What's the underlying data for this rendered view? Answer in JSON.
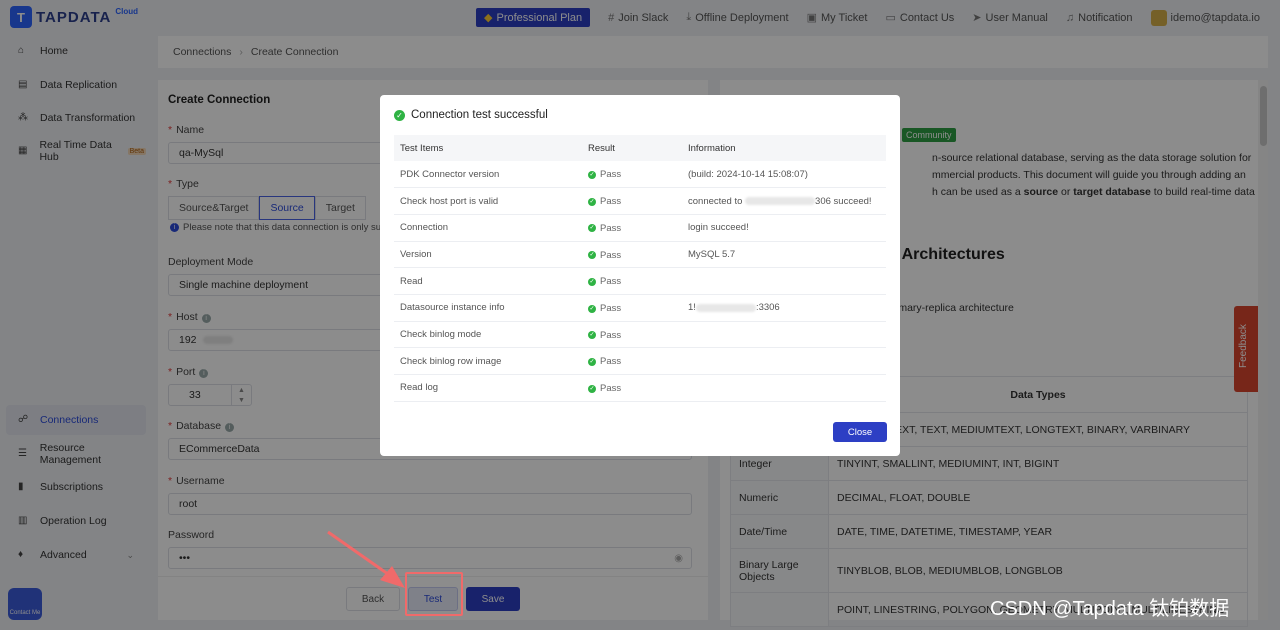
{
  "brand": {
    "name": "TAPDATA",
    "tag": "Cloud"
  },
  "topnav": {
    "plan": "Professional Plan",
    "slack": "Join Slack",
    "offline": "Offline Deployment",
    "ticket": "My Ticket",
    "contact": "Contact Us",
    "manual": "User Manual",
    "notification": "Notification",
    "user": "idemo@tapdata.io"
  },
  "sidebar": {
    "items": [
      {
        "label": "Home",
        "icon": "home-icon"
      },
      {
        "label": "Data Replication",
        "icon": "replication-icon"
      },
      {
        "label": "Data Transformation",
        "icon": "transform-icon"
      },
      {
        "label": "Real Time Data Hub",
        "icon": "hub-icon",
        "badge": "Beta"
      },
      {
        "label": "Connections",
        "icon": "connections-icon",
        "active": true
      },
      {
        "label": "Resource Management",
        "icon": "resource-icon"
      },
      {
        "label": "Subscriptions",
        "icon": "subscriptions-icon"
      },
      {
        "label": "Operation Log",
        "icon": "log-icon"
      },
      {
        "label": "Advanced",
        "icon": "advanced-icon"
      }
    ],
    "contact_me": "Contact Me"
  },
  "breadcrumb": {
    "root": "Connections",
    "current": "Create Connection"
  },
  "form": {
    "title": "Create Connection",
    "name_label": "Name",
    "name_value": "qa-MySql",
    "type_label": "Type",
    "type_options": [
      "Source&Target",
      "Source",
      "Target"
    ],
    "type_selected": "Source",
    "type_note": "Please note that this data connection is only sui",
    "deploy_label": "Deployment Mode",
    "deploy_value": "Single machine deployment",
    "host_label": "Host",
    "host_value": "192",
    "port_label": "Port",
    "port_value": "33",
    "database_label": "Database",
    "database_value": "ECommerceData",
    "username_label": "Username",
    "username_value": "root",
    "password_label": "Password",
    "password_value": "•••"
  },
  "buttons": {
    "back": "Back",
    "test": "Test",
    "save": "Save"
  },
  "doc": {
    "badge": "Community",
    "line1": "n-source relational database, serving as the data storage solution for",
    "line2": "mmercial products. This document will guide you through adding an",
    "line3_pre": "h can be used as a ",
    "line3_b1": "source",
    "line3_mid": " or ",
    "line3_b2": "target database",
    "line3_post": " to build real-time data",
    "heading": "d Architectures",
    "arch": "imary-replica architecture",
    "table_header": "Data Types",
    "rows": [
      {
        "cat": "",
        "types": "HAR, TINYTEXT, TEXT, MEDIUMTEXT, LONGTEXT, BINARY, VARBINARY"
      },
      {
        "cat": "Integer",
        "types": "TINYINT, SMALLINT, MEDIUMINT, INT, BIGINT"
      },
      {
        "cat": "Numeric",
        "types": "DECIMAL, FLOAT, DOUBLE"
      },
      {
        "cat": "Date/Time",
        "types": "DATE, TIME, DATETIME, TIMESTAMP, YEAR"
      },
      {
        "cat": "Binary Large Objects",
        "types": "TINYBLOB, BLOB, MEDIUMBLOB, LONGBLOB"
      },
      {
        "cat": "",
        "types": "POINT, LINESTRING, POLYGON, GEOMETRY, MULTIPOINT, MULTILINESTRING"
      }
    ],
    "feedback": "Feedback"
  },
  "modal": {
    "title": "Connection test successful",
    "headers": [
      "Test Items",
      "Result",
      "Information"
    ],
    "rows": [
      {
        "item": "PDK Connector version",
        "result": "Pass",
        "info": "(build: 2024-10-14 15:08:07)"
      },
      {
        "item": "Check host port is valid",
        "result": "Pass",
        "info_pre": "connected to",
        "info_post": "306 succeed!"
      },
      {
        "item": "Connection",
        "result": "Pass",
        "info": "login succeed!"
      },
      {
        "item": "Version",
        "result": "Pass",
        "info": "MySQL 5.7"
      },
      {
        "item": "Read",
        "result": "Pass",
        "info": ""
      },
      {
        "item": "Datasource instance info",
        "result": "Pass",
        "info_pre": "1!",
        "info_post": ":3306"
      },
      {
        "item": "Check binlog mode",
        "result": "Pass",
        "info": ""
      },
      {
        "item": "Check binlog row image",
        "result": "Pass",
        "info": ""
      },
      {
        "item": "Read log",
        "result": "Pass",
        "info": ""
      }
    ],
    "close": "Close"
  },
  "watermark": "CSDN @Tapdata 钛铂数据",
  "colors": {
    "primary": "#2d3fc4",
    "success": "#2fb344",
    "annotation": "#f06a6a"
  }
}
